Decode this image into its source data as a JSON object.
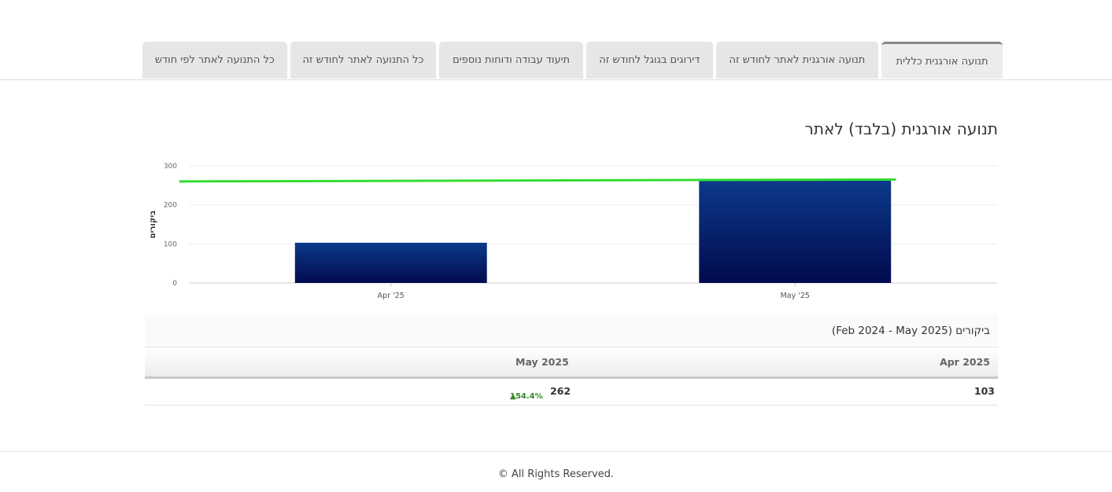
{
  "tabs": [
    {
      "label": "תנועה אורגנית כללית",
      "active": true
    },
    {
      "label": "תנועה אורגנית לאתר לחודש זה",
      "active": false
    },
    {
      "label": "דירוגים בגוגל לחודש זה",
      "active": false
    },
    {
      "label": "תיעוד עבודה ודוחות נוספים",
      "active": false
    },
    {
      "label": "כל התנועה לאתר לחודש זה",
      "active": false
    },
    {
      "label": "כל התנועה לאתר לפי חודש",
      "active": false
    }
  ],
  "page_title": "תנועה אורגנית (בלבד) לאתר",
  "chart_data": {
    "type": "bar",
    "categories": [
      "Apr '25",
      "May '25"
    ],
    "series": [
      {
        "values": [
          103,
          262
        ],
        "color": "#0a2a78",
        "type": "bar"
      },
      {
        "values": [
          260,
          265
        ],
        "color": "#33dd33",
        "type": "line"
      }
    ],
    "ylabel": "ביקורים",
    "ylim": [
      0,
      300
    ],
    "yticks": [
      0,
      100,
      200,
      300
    ],
    "grid": true
  },
  "table": {
    "caption": "ביקורים (Feb 2024 - May 2025)",
    "headers": {
      "apr": "Apr 2025",
      "may": "May 2025"
    },
    "row": {
      "apr": "103",
      "may": "262",
      "may_delta": "154.4%"
    }
  },
  "footer": {
    "text": "© All Rights Reserved."
  }
}
